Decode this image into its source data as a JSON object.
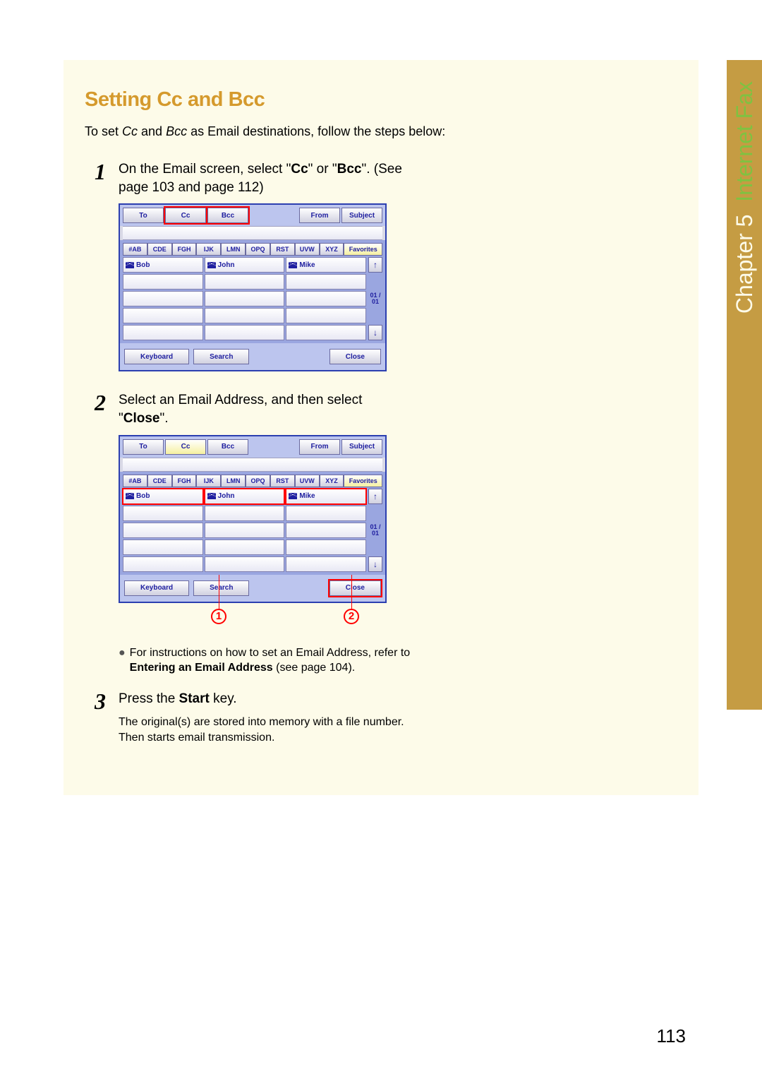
{
  "chapter": {
    "label": "Chapter 5",
    "section": "Internet Fax"
  },
  "heading": "Setting Cc and Bcc",
  "intro_pre": "To set ",
  "intro_cc": "Cc",
  "intro_mid": " and ",
  "intro_bcc": "Bcc",
  "intro_post": " as Email destinations, follow the steps below:",
  "steps": {
    "one": {
      "num": "1",
      "pre": "On the Email screen, select \"",
      "b1": "Cc",
      "mid": "\" or \"",
      "b2": "Bcc",
      "post": "\". (See page 103 and page 112)"
    },
    "two": {
      "num": "2",
      "pre": "Select an Email Address, and then select \"",
      "b1": "Close",
      "post": "\".",
      "bullet_pre": "For instructions on how to set an Email Address, refer to ",
      "bullet_b": "Entering an Email Address",
      "bullet_post": " (see page 104)."
    },
    "three": {
      "num": "3",
      "pre": "Press the ",
      "b1": "Start",
      "post": " key.",
      "sub": "The original(s) are stored into memory with a file number. Then starts email transmission."
    }
  },
  "panel": {
    "tabs": {
      "to": "To",
      "cc": "Cc",
      "bcc": "Bcc",
      "from": "From",
      "subject": "Subject"
    },
    "alpha": [
      "#AB",
      "CDE",
      "FGH",
      "IJK",
      "LMN",
      "OPQ",
      "RST",
      "UVW",
      "XYZ"
    ],
    "fav": "Favorites",
    "names": [
      "Bob",
      "John",
      "Mike"
    ],
    "page1": "01\n/\n01",
    "footer": {
      "keyboard": "Keyboard",
      "search": "Search",
      "close": "Close"
    }
  },
  "callouts": {
    "one": "1",
    "two": "2"
  },
  "page_num": "113"
}
